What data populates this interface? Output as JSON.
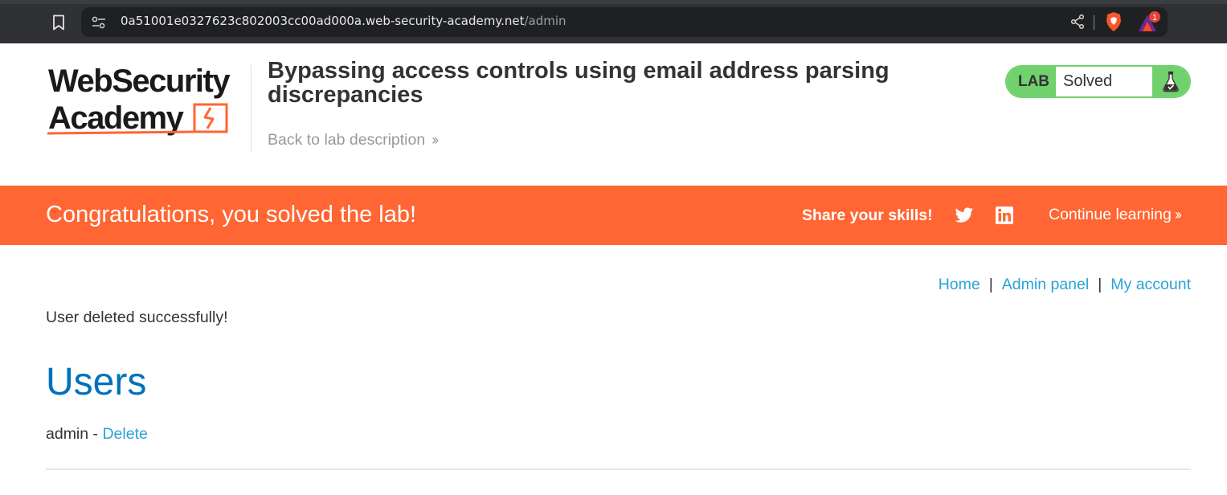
{
  "browser": {
    "url_host": "0a51001e0327623c802003cc00ad000a.web-security-academy.net",
    "url_path": "/admin",
    "rewards_badge": "1"
  },
  "header": {
    "logo_line1": "WebSecurity",
    "logo_line2": "Academy",
    "lab_title": "Bypassing access controls using email address parsing discrepancies",
    "back_link": "Back to lab description",
    "lab_label": "LAB",
    "lab_status": "Solved"
  },
  "banner": {
    "message": "Congratulations, you solved the lab!",
    "share_label": "Share your skills!",
    "continue_link": "Continue learning"
  },
  "nav": {
    "home": "Home",
    "admin_panel": "Admin panel",
    "my_account": "My account",
    "separator": "|"
  },
  "content": {
    "status_message": "User deleted successfully!",
    "users_heading": "Users",
    "users": [
      {
        "name": "admin",
        "separator": "-",
        "action": "Delete"
      }
    ]
  },
  "colors": {
    "banner": "#ff6633",
    "lab_green": "#70d16d",
    "heading_blue": "#0071bc",
    "link_blue": "#29a3d6"
  }
}
